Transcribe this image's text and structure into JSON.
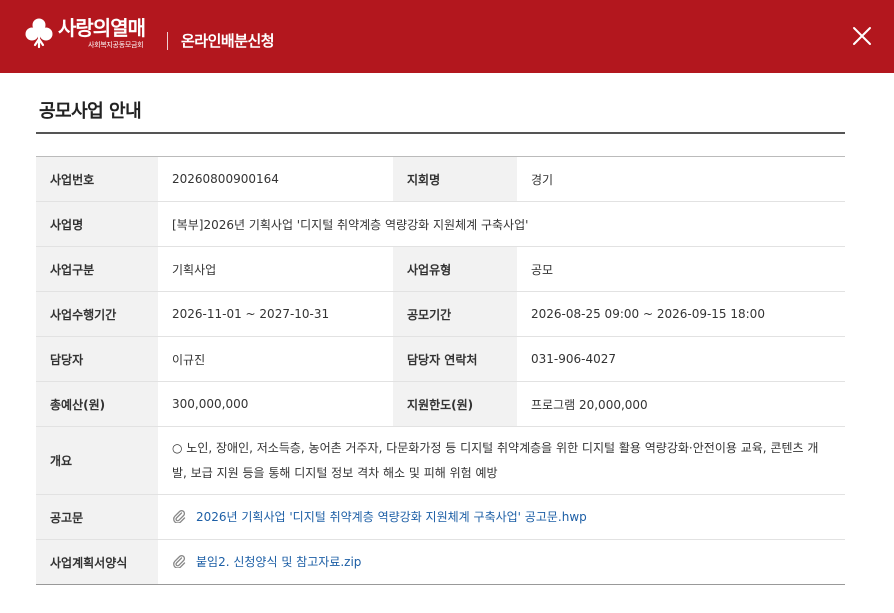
{
  "header": {
    "brand_name": "사랑의열매",
    "brand_sub": "사회복지공동모금회",
    "title": "온라인배분신청",
    "bg_color": "#b3171e"
  },
  "page": {
    "title": "공모사업 안내"
  },
  "info": {
    "business_no_label": "사업번호",
    "business_no": "20260800900164",
    "branch_label": "지회명",
    "branch": "경기",
    "business_name_label": "사업명",
    "business_name": "[복부]2026년 기획사업 '디지털 취약계층 역량강화 지원체계 구축사업'",
    "category_label": "사업구분",
    "category": "기획사업",
    "type_label": "사업유형",
    "type": "공모",
    "period_label": "사업수행기간",
    "period": "2026-11-01 ~ 2027-10-31",
    "call_period_label": "공모기간",
    "call_period": "2026-08-25 09:00 ~ 2026-09-15 18:00",
    "manager_label": "담당자",
    "manager": "이규진",
    "contact_label": "담당자 연락처",
    "contact": "031-906-4027",
    "budget_label": "총예산(원)",
    "budget": "300,000,000",
    "limit_label": "지원한도(원)",
    "limit": "프로그램 20,000,000",
    "overview_label": "개요",
    "overview": "○ 노인, 장애인, 저소득층, 농어촌 거주자, 다문화가정 등 디지털 취약계층을 위한 디지털 활용 역량강화·안전이용 교육, 콘텐츠 개발, 보급 지원 등을 통해 디지털 정보 격차 해소 및 피해 위험 예방",
    "notice_label": "공고문",
    "notice_file": "2026년 기획사업 '디지털 취약계층 역량강화 지원체계 구축사업' 공고문.hwp",
    "plan_label": "사업계획서양식",
    "plan_file": "붙임2. 신청양식 및 참고자료.zip",
    "link_color": "#1d5fa6"
  }
}
